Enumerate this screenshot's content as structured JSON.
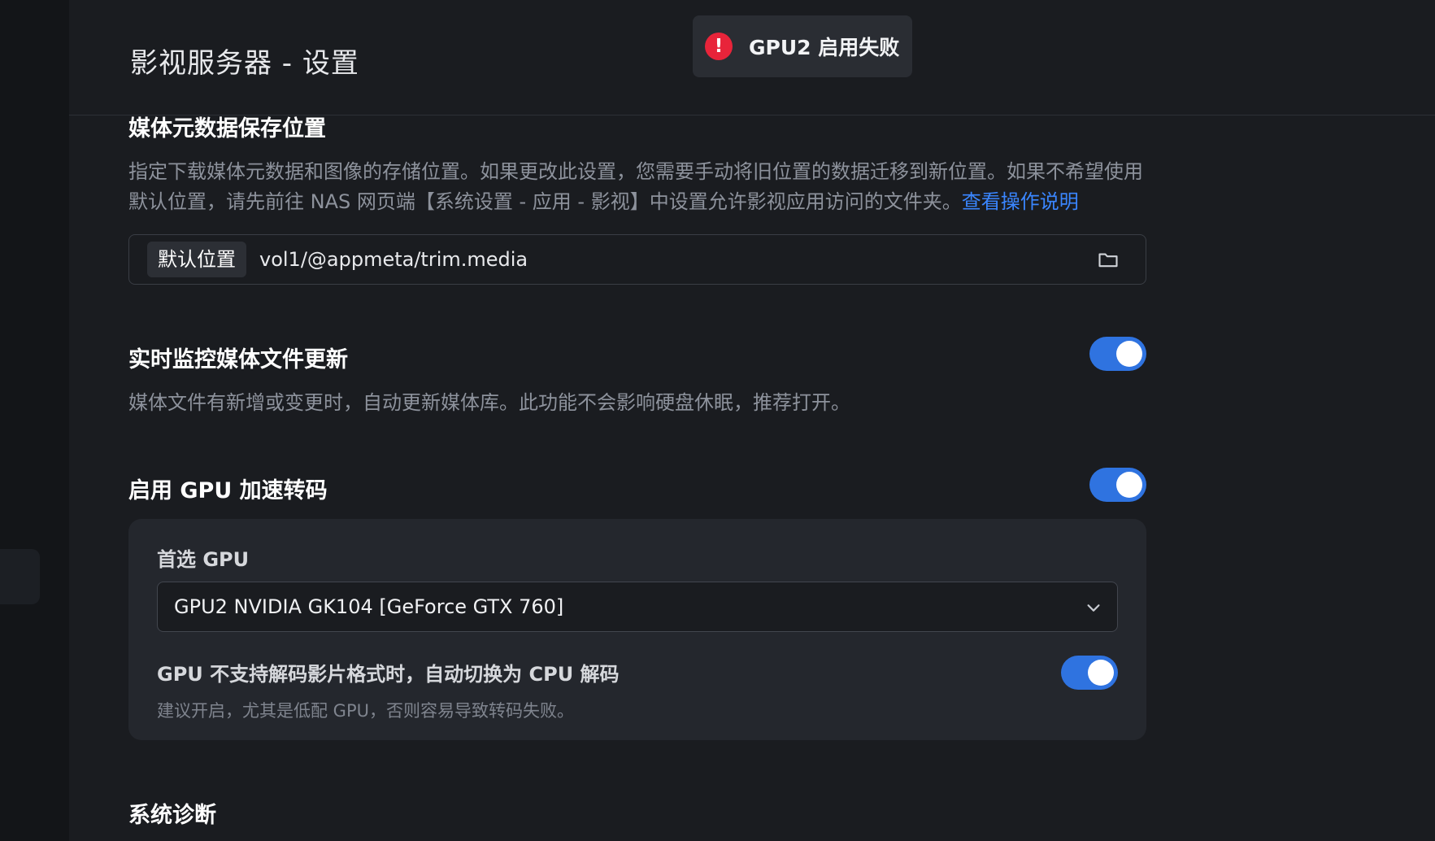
{
  "header": {
    "title": "影视服务器 - 设置"
  },
  "toast": {
    "icon": "error-icon",
    "text": "GPU2 启用失败",
    "color": "#e8243a"
  },
  "metadata_location": {
    "title": "媒体元数据保存位置",
    "description": "指定下载媒体元数据和图像的存储位置。如果更改此设置，您需要手动将旧位置的数据迁移到新位置。如果不希望使用默认位置，请先前往 NAS 网页端【系统设置 - 应用 - 影视】中设置允许影视应用访问的文件夹。",
    "link": "查看操作说明",
    "tag": "默认位置",
    "path": "vol1/@appmeta/trim.media",
    "icon": "folder-icon"
  },
  "realtime_monitor": {
    "title": "实时监控媒体文件更新",
    "description": "媒体文件有新增或变更时，自动更新媒体库。此功能不会影响硬盘休眠，推荐打开。",
    "enabled": true
  },
  "gpu_accel": {
    "title": "启用 GPU 加速转码",
    "enabled": true,
    "preferred_label": "首选 GPU",
    "selected_gpu": "GPU2 NVIDIA GK104 [GeForce GTX 760]",
    "fallback_title": "GPU 不支持解码影片格式时，自动切换为 CPU 解码",
    "fallback_desc": "建议开启，尤其是低配 GPU，否则容易导致转码失败。",
    "fallback_enabled": true
  },
  "diagnostics": {
    "title": "系统诊断"
  },
  "colors": {
    "accent": "#2f73e0",
    "link": "#3a86ff",
    "background": "#1a1c20"
  }
}
